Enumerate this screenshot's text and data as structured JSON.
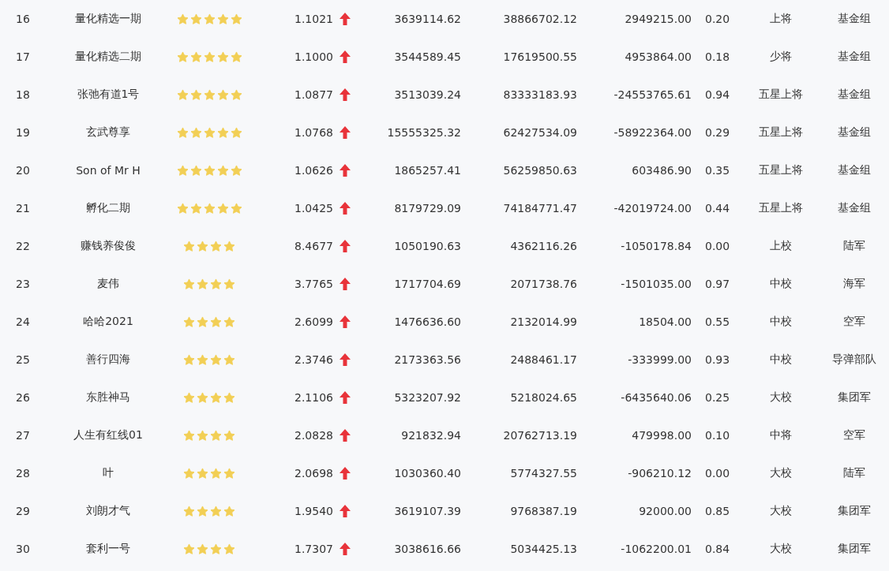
{
  "rows": [
    {
      "rank": "16",
      "name": "量化精选一期",
      "stars": 5,
      "value": "1.1021",
      "up": true,
      "column_5": "3639114.62",
      "column_6": "38866702.12",
      "column_7": "2949215.00",
      "column_8": "0.20",
      "column_9": "上将",
      "column_10": "基金组"
    },
    {
      "rank": "17",
      "name": "量化精选二期",
      "stars": 5,
      "value": "1.1000",
      "up": true,
      "column_5": "3544589.45",
      "column_6": "17619500.55",
      "column_7": "4953864.00",
      "column_8": "0.18",
      "column_9": "少将",
      "column_10": "基金组"
    },
    {
      "rank": "18",
      "name": "张弛有道1号",
      "stars": 5,
      "value": "1.0877",
      "up": true,
      "column_5": "3513039.24",
      "column_6": "83333183.93",
      "column_7": "-24553765.61",
      "column_8": "0.94",
      "column_9": "五星上将",
      "column_10": "基金组"
    },
    {
      "rank": "19",
      "name": "玄武尊享",
      "stars": 5,
      "value": "1.0768",
      "up": true,
      "column_5": "15555325.32",
      "column_6": "62427534.09",
      "column_7": "-58922364.00",
      "column_8": "0.29",
      "column_9": "五星上将",
      "column_10": "基金组"
    },
    {
      "rank": "20",
      "name": "Son of Mr H",
      "stars": 5,
      "value": "1.0626",
      "up": true,
      "column_5": "1865257.41",
      "column_6": "56259850.63",
      "column_7": "603486.90",
      "column_8": "0.35",
      "column_9": "五星上将",
      "column_10": "基金组"
    },
    {
      "rank": "21",
      "name": "孵化二期",
      "stars": 5,
      "value": "1.0425",
      "up": true,
      "column_5": "8179729.09",
      "column_6": "74184771.47",
      "column_7": "-42019724.00",
      "column_8": "0.44",
      "column_9": "五星上将",
      "column_10": "基金组"
    },
    {
      "rank": "22",
      "name": "赚钱养俊俊",
      "stars": 4,
      "value": "8.4677",
      "up": true,
      "column_5": "1050190.63",
      "column_6": "4362116.26",
      "column_7": "-1050178.84",
      "column_8": "0.00",
      "column_9": "上校",
      "column_10": "陆军"
    },
    {
      "rank": "23",
      "name": "麦伟",
      "stars": 4,
      "value": "3.7765",
      "up": true,
      "column_5": "1717704.69",
      "column_6": "2071738.76",
      "column_7": "-1501035.00",
      "column_8": "0.97",
      "column_9": "中校",
      "column_10": "海军"
    },
    {
      "rank": "24",
      "name": "哈哈2021",
      "stars": 4,
      "value": "2.6099",
      "up": true,
      "column_5": "1476636.60",
      "column_6": "2132014.99",
      "column_7": "18504.00",
      "column_8": "0.55",
      "column_9": "中校",
      "column_10": "空军"
    },
    {
      "rank": "25",
      "name": "善行四海",
      "stars": 4,
      "value": "2.3746",
      "up": true,
      "column_5": "2173363.56",
      "column_6": "2488461.17",
      "column_7": "-333999.00",
      "column_8": "0.93",
      "column_9": "中校",
      "column_10": "导弹部队"
    },
    {
      "rank": "26",
      "name": "东胜神马",
      "stars": 4,
      "value": "2.1106",
      "up": true,
      "column_5": "5323207.92",
      "column_6": "5218024.65",
      "column_7": "-6435640.06",
      "column_8": "0.25",
      "column_9": "大校",
      "column_10": "集团军"
    },
    {
      "rank": "27",
      "name": "人生有红线01",
      "stars": 4,
      "value": "2.0828",
      "up": true,
      "column_5": "921832.94",
      "column_6": "20762713.19",
      "column_7": "479998.00",
      "column_8": "0.10",
      "column_9": "中将",
      "column_10": "空军"
    },
    {
      "rank": "28",
      "name": "叶",
      "stars": 4,
      "value": "2.0698",
      "up": true,
      "column_5": "1030360.40",
      "column_6": "5774327.55",
      "column_7": "-906210.12",
      "column_8": "0.00",
      "column_9": "大校",
      "column_10": "陆军"
    },
    {
      "rank": "29",
      "name": "刘朗才气",
      "stars": 4,
      "value": "1.9540",
      "up": true,
      "column_5": "3619107.39",
      "column_6": "9768387.19",
      "column_7": "92000.00",
      "column_8": "0.85",
      "column_9": "大校",
      "column_10": "集团军"
    },
    {
      "rank": "30",
      "name": "套利一号",
      "stars": 4,
      "value": "1.7307",
      "up": true,
      "column_5": "3038616.66",
      "column_6": "5034425.13",
      "column_7": "-1062200.01",
      "column_8": "0.84",
      "column_9": "大校",
      "column_10": "集团军"
    }
  ]
}
